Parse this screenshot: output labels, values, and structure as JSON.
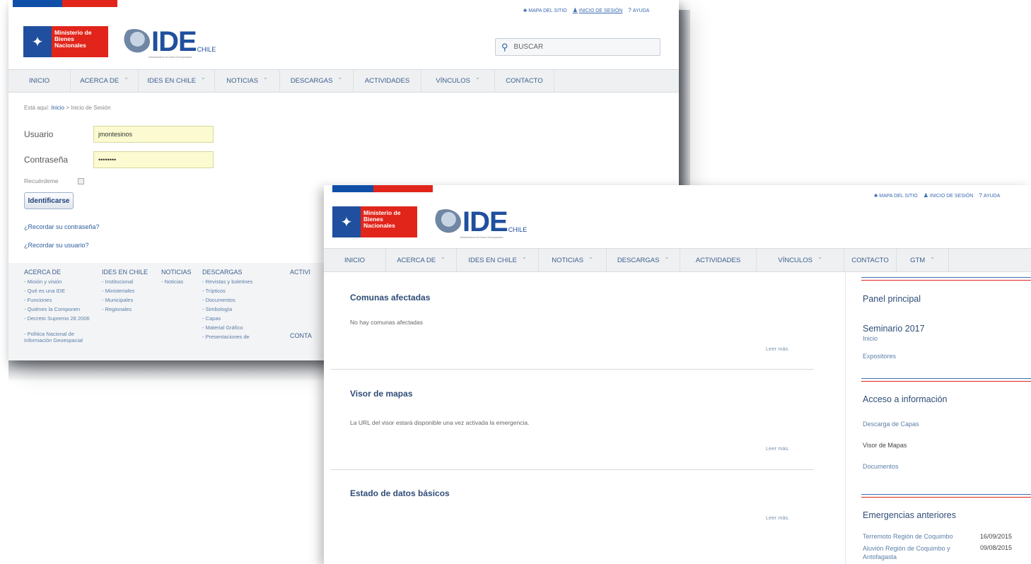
{
  "login_window": {
    "toplinks": [
      "MAPA DEL SITIO",
      "INICIO DE SESIÓN",
      "AYUDA"
    ],
    "ministry_logo": "Ministerio de Bienes Nacionales",
    "ide_logo": "IDE",
    "ide_chile": "CHILE",
    "ide_sub": "Infraestructura de Datos Geoespaciales",
    "search_placeholder": "BUSCAR",
    "nav": [
      "INICIO",
      "ACERCA DE",
      "IDES EN CHILE",
      "NOTICIAS",
      "DESCARGAS",
      "ACTIVIDADES",
      "VÍNCULOS",
      "CONTACTO"
    ],
    "breadcrumb_prefix": "Está aquí:",
    "breadcrumb_home": "Inicio",
    "breadcrumb_sep": ">",
    "breadcrumb_current": "Inicio de Sesión",
    "username_label": "Usuario",
    "username_value": "jmontesinos",
    "password_label": "Contraseña",
    "password_value": "••••••••",
    "remember_label": "Recuérdeme",
    "login_button": "Identificarse",
    "forgot_password": "¿Recordar su contraseña?",
    "forgot_user": "¿Recordar su usuario?",
    "footer": {
      "acerca_head": "ACERCA DE",
      "acerca_items": [
        "Misión y visión",
        "Qué es una IDE",
        "Funciones",
        "Quiénes la Componen",
        "Decreto Supremo 28 2006",
        "Política Nacional de Información Geoespacial"
      ],
      "ides_head": "IDES EN CHILE",
      "ides_items": [
        "Institucional",
        "Ministeriales",
        "Municipales",
        "Regionales"
      ],
      "noticias_head": "NOTICIAS",
      "noticias_items": [
        "Noticias"
      ],
      "descargas_head": "DESCARGAS",
      "descargas_items": [
        "Revistas y boletines",
        "Trípticos",
        "Documentos",
        "Simbología",
        "Capas",
        "Material Gráfico",
        "Presentaciones de"
      ],
      "actividades_head": "ACTIVI",
      "contacto_head": "CONTA"
    }
  },
  "main_window": {
    "toplinks": [
      "MAPA DEL SITIO",
      "INICIO DE SESIÓN",
      "AYUDA"
    ],
    "ministry_logo": "Ministerio de Bienes Nacionales",
    "ide_logo": "IDE",
    "ide_chile": "CHILE",
    "ide_sub": "Infraestructura de Datos Geoespaciales",
    "nav": [
      "INICIO",
      "ACERCA DE",
      "IDES EN CHILE",
      "NOTICIAS",
      "DESCARGAS",
      "ACTIVIDADES",
      "VÍNCULOS",
      "CONTACTO",
      "GTM"
    ],
    "sections": [
      {
        "title": "Comunas afectadas",
        "text": "No hay comunas afectadas",
        "more": "Leer más."
      },
      {
        "title": "Visor de mapas",
        "text": "La URL del visor estará disponible una vez activada la emergencia.",
        "more": "Leer más."
      },
      {
        "title": "Estado de datos básicos",
        "text": "",
        "more": "Leer más."
      }
    ],
    "sidebar": {
      "panel_title": "Panel principal",
      "seminar_title": "Seminario 2017",
      "seminar_links": [
        "Inicio",
        "Expositores"
      ],
      "access_title": "Acceso a información",
      "access_links": [
        "Descarga de Capas",
        "Visor de Mapas",
        "Documentos"
      ],
      "emergencies_title": "Emergencias anteriores",
      "emergencies": [
        {
          "name": "Terremoto Región de Coquimbo",
          "date": "16/09/2015"
        },
        {
          "name": "Aluvión Región de Coquimbo y Antofagasta",
          "date": "09/08/2015"
        }
      ]
    }
  },
  "colors": {
    "blue": "#1f4f9e",
    "red": "#e1251b",
    "link": "#2f5f9e",
    "field_bg": "#fbfad0"
  }
}
